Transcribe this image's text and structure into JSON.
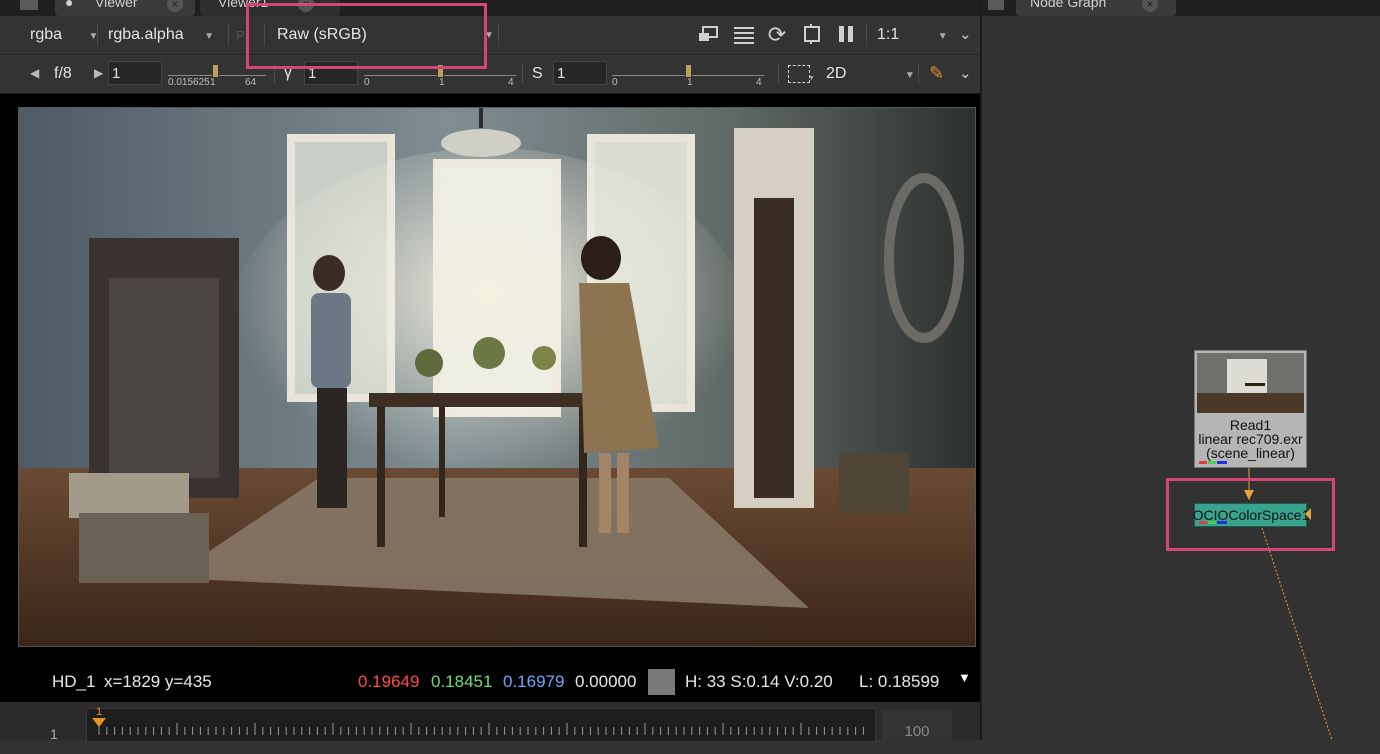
{
  "tabs": {
    "viewer": "Viewer",
    "viewer1": "Viewer1",
    "node_graph": "Node Graph"
  },
  "toolbar": {
    "channels": "rgba",
    "alpha_channel": "rgba.alpha",
    "colorspace": "Raw (sRGB)",
    "zoom": "1:1"
  },
  "exposure": {
    "fstop_label": "f/8",
    "gain_value": "1",
    "gain_ticks": [
      "0.015625",
      "1",
      "64"
    ],
    "gamma_label": "γ",
    "gamma_value": "1",
    "gamma_ticks": [
      "0",
      "1",
      "4"
    ],
    "saturation_label": "S",
    "saturation_value": "1",
    "saturation_ticks": [
      "0",
      "1",
      "4"
    ],
    "view_mode": "2D"
  },
  "info": {
    "format": "HD_1",
    "coords": "x=1829 y=435",
    "r": "0.19649",
    "g": "0.18451",
    "b": "0.16979",
    "a": "0.00000",
    "hsv": "H: 33 S:0.14 V:0.20",
    "luminance": "L: 0.18599",
    "swatch_color": "#7a7a7a"
  },
  "timeline": {
    "start": "1",
    "end": "100",
    "current": "1"
  },
  "nodes": {
    "read": {
      "name": "Read1",
      "file": "linear rec709.exr",
      "colorspace": "(scene_linear)"
    },
    "ocio": {
      "name": "OCIOColorSpace1"
    }
  },
  "colors": {
    "highlight": "#d4467a",
    "ocio_node": "#3aa38e",
    "red": "#ff4b4b",
    "green": "#6ee06e",
    "blue": "#6aa8ff"
  }
}
